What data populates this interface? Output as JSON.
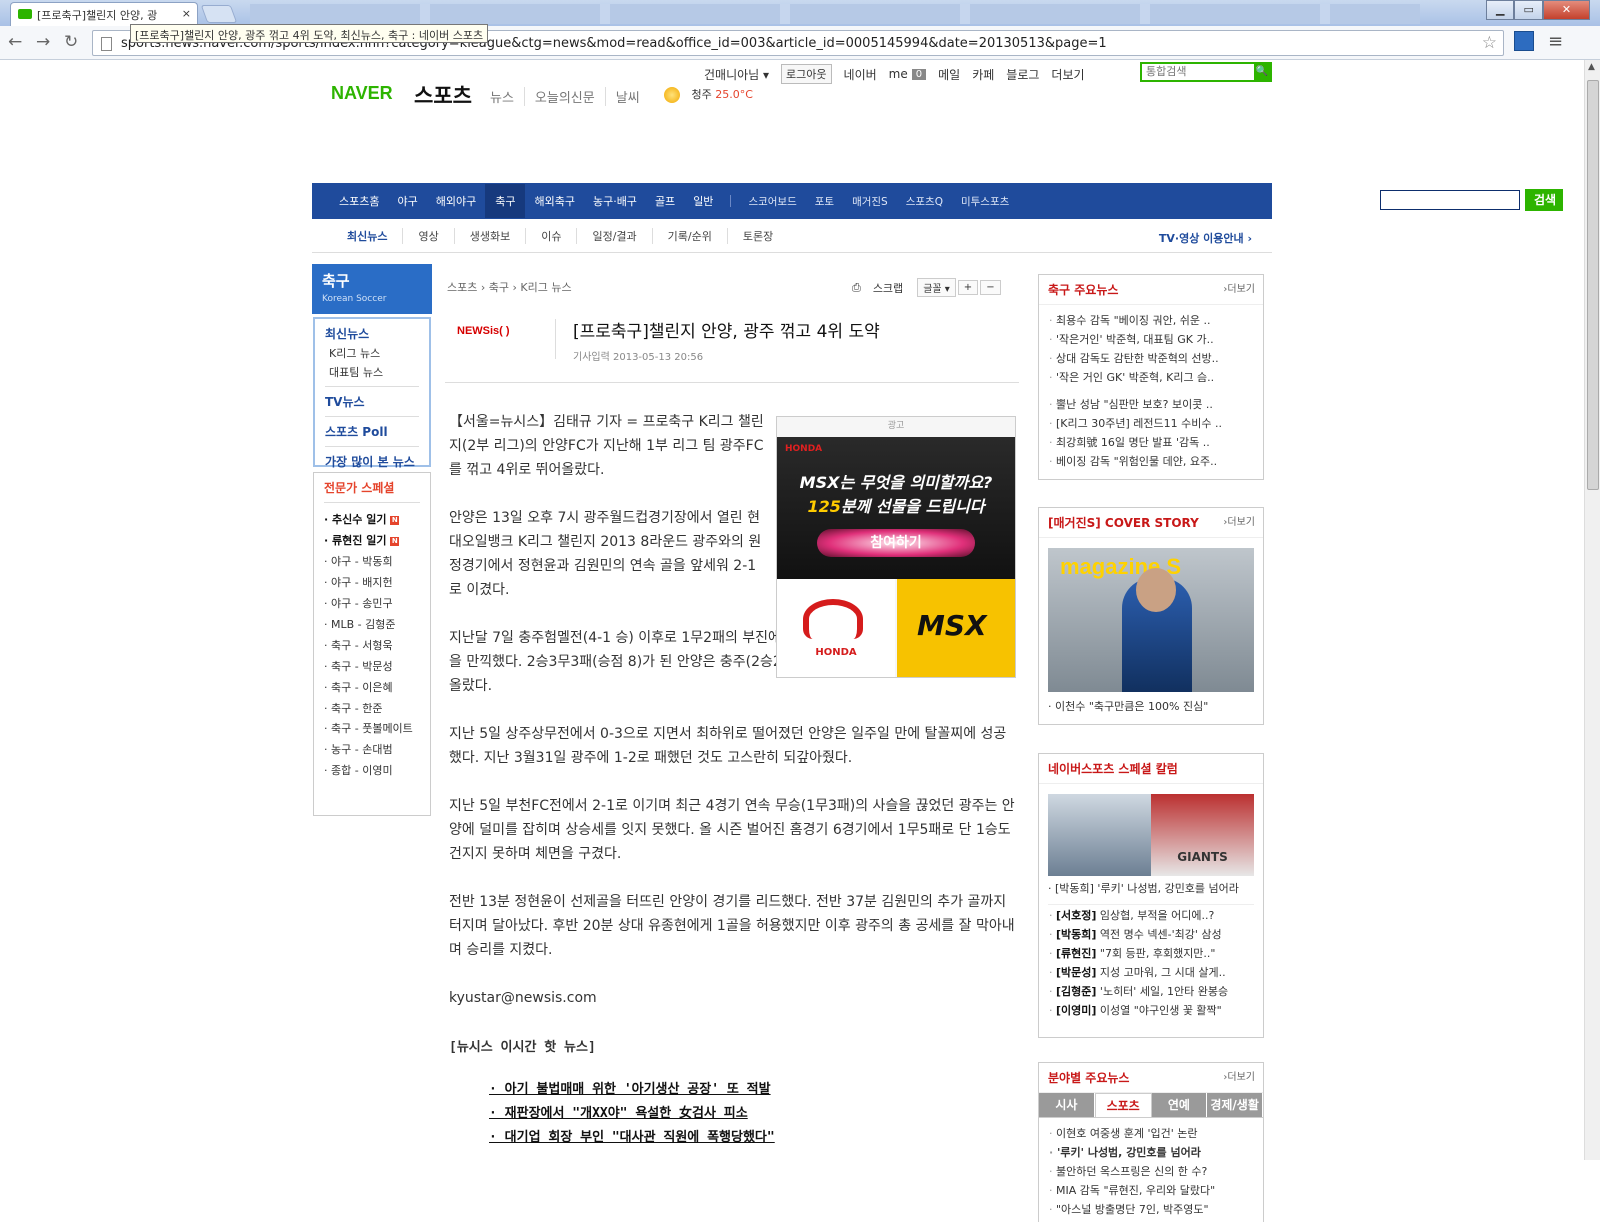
{
  "browser": {
    "tab_title": "[프로축구]챌린지 안양, 광",
    "tab_close": "×",
    "url": "sports.news.naver.com/sports/index.nhn?category=kleague&ctg=news&mod=read&office_id=003&article_id=0005145994&date=20130513&page=1",
    "tooltip": "[프로축구]챌린지 안양, 광주 꺾고 4위 도약, 최신뉴스, 축구 : 네이버 스포츠",
    "win_min": "▁",
    "win_max": "▭",
    "win_close": "✕"
  },
  "gnb": {
    "user": "건매니아님",
    "logout": "로그아웃",
    "links": [
      "네이버",
      "me",
      "메일",
      "카페",
      "블로그",
      "더보기"
    ],
    "me_count": "0",
    "search_placeholder": "통합검색"
  },
  "header": {
    "logo": "NAVER",
    "logo_sub": "스포츠",
    "menu": [
      "뉴스",
      "오늘의신문",
      "날씨"
    ],
    "weather_city": "청주",
    "weather_temp": "25.0°C"
  },
  "mainnav": {
    "items": [
      "스포츠홈",
      "야구",
      "해외야구",
      "축구",
      "해외축구",
      "농구·배구",
      "골프",
      "일반"
    ],
    "extra": [
      "스코어보드",
      "포토",
      "매거진S",
      "스포츠Q",
      "미투스포츠"
    ],
    "search_btn": "검색"
  },
  "subnav": {
    "items": [
      "최신뉴스",
      "영상",
      "생생화보",
      "이슈",
      "일정/결과",
      "기록/순위",
      "토론장"
    ],
    "tv": "TV·영상 이용안내 ›"
  },
  "lnb": {
    "title": "축구",
    "subtitle": "Korean Soccer",
    "latest": "최신뉴스",
    "latest_items": [
      "K리그 뉴스",
      "대표팀 뉴스"
    ],
    "tv": "TV뉴스",
    "poll": "스포츠 Poll",
    "most": "가장 많이 본 뉴스",
    "special_title": "전문가 스페셜",
    "special_bold": [
      "추신수 일기",
      "류현진 일기"
    ],
    "special_new": "N",
    "special_items": [
      "야구 - 박동희",
      "야구 - 배지헌",
      "야구 - 송민구",
      "MLB - 김형준",
      "축구 - 서형욱",
      "축구 - 박문성",
      "축구 - 이은혜",
      "축구 - 한준",
      "축구 - 풋볼메이트",
      "농구 - 손대범",
      "종합 - 이영미"
    ]
  },
  "article": {
    "breadcrumb": "스포츠 › 축구 › K리그 뉴스",
    "print_label": "⎙",
    "scrap_label": "스크랩",
    "font_label": "글꼴 ▾",
    "plus": "+",
    "minus": "−",
    "source": "NEWSis( )",
    "title": "[프로축구]챌린지 안양, 광주 꺾고 4위 도약",
    "date": "기사입력 2013-05-13 20:56",
    "p1": "【서울=뉴시스】김태규 기자 = 프로축구 K리그 챌린지(2부 리그)의 안양FC가 지난해 1부 리그 팀 광주FC를 꺾고 4위로 뛰어올랐다.",
    "p2": "안양은 13일 오후 7시 광주월드컵경기장에서 열린 현대오일뱅크 K리그 챌린지 2013 8라운드 광주와의 원정경기에서 정현윤과 김원민의 연속 골을 앞세워 2-1로 이겼다.",
    "p3": "지난달 7일 충주험멜전(4-1 승) 이후로 1무2패의 부진에 빠졌던 안양은 4경기 만에 승리의 기쁨을 만끽했다. 2승3무3패(승점 8)가 된 안양은 충주(2승2무4패·승점 8)를 끌어내리고 4위로 뛰어올랐다.",
    "p4": "지난 5일 상주상무전에서 0-3으로 지면서 최하위로 떨어졌던 안양은 일주일 만에 탈꼴찌에 성공했다. 지난 3월31일 광주에 1-2로 패했던 것도 고스란히 되갚아줬다.",
    "p5": "지난 5일 부천FC전에서 2-1로 이기며 최근 4경기 연속 무승(1무3패)의 사슬을 끊었던 광주는 안양에 덜미를 잡히며 상승세를 잇지 못했다. 올 시즌 벌어진 홈경기 6경기에서 1무5패로 단 1승도 건지지 못하며 체면을 구겼다.",
    "p6": "전반 13분 정현윤이 선제골을 터뜨린 안양이 경기를 리드했다. 전반 37분 김원민의 추가 골까지 터지며 달아났다. 후반 20분 상대 유종현에게 1골을 허용했지만 이후 광주의 총 공세를 잘 막아내며 승리를 지켰다.",
    "email": "kyustar@newsis.com",
    "hot_title": "[뉴시스 이시간 핫 뉴스]",
    "hot": [
      "·  아기 불법매매 위한 '아기생산 공장' 또 적발",
      "·  재판장에서 \"개XX야\" 욕설한 女검사 피소",
      "·  대기업 회장 부인 \"대사관 직원에 폭행당했다\""
    ]
  },
  "ad": {
    "label": "광고",
    "brand": "HONDA",
    "line1": "MSX는 무엇을 의미할까요?",
    "line2_num": "125",
    "line2": "분께 선물을 드립니다",
    "cta": "참여하기",
    "logo_text": "HONDA",
    "product": "MSX"
  },
  "side": {
    "more": "›더보기",
    "s1_title": "축구 주요뉴스",
    "s1_items": [
      "최용수 감독 \"베이징 궈안, 쉬운 ..",
      "'작은거인' 박준혁, 대표팀 GK 가..",
      "상대 감독도 감탄한 박준혁의 선방..",
      "'작은 거인 GK' 박준혁, K리그 슴..",
      "뿔난 성남 \"심판만 보호? 보이콧 ..",
      "[K리그 30주년] 레전드11 수비수 ..",
      "최강희號 16일 명단 발표 '감독 ..",
      "베이징 감독 \"위험인물 데얀, 요주.."
    ],
    "s2_title": "[매거진S] COVER STORY",
    "s2_mag": "magazine S",
    "s2_caption": "· 이천수 \"축구만큼은 100% 진심\"",
    "s3_title": "네이버스포츠 스페셜 칼럼",
    "s3_img_text": "GIANTS",
    "s3_caption": "· [박동희] '루키' 나성범, 강민호를 넘어라",
    "s3_items": [
      {
        "who": "[서호정]",
        "txt": "임상협, 부적을 어디에..?"
      },
      {
        "who": "[박동희]",
        "txt": "역전 명수 넥센-'최강' 삼성"
      },
      {
        "who": "[류현진]",
        "txt": "\"7회 등판, 후회했지만..\""
      },
      {
        "who": "[박문성]",
        "txt": "지성 고마워, 그 시대 살게.."
      },
      {
        "who": "[김형준]",
        "txt": "'노히터' 세일, 1안타 완봉승"
      },
      {
        "who": "[이영미]",
        "txt": "이성열 \"야구인생 꽃 활짝\""
      }
    ],
    "s4_title": "분야별 주요뉴스",
    "s4_tabs": [
      "시사",
      "스포츠",
      "연예",
      "경제/생활"
    ],
    "s4_items": [
      "이현호 여중생 훈계 '입건' 논란",
      "'루키' 나성범, 강민호를 넘어라",
      "불안하던 옥스프링은 신의 한 수?",
      "MIA 감독 \"류현진, 우리와 달랐다\"",
      "\"아스널 방출명단 7인, 박주영도\""
    ]
  }
}
